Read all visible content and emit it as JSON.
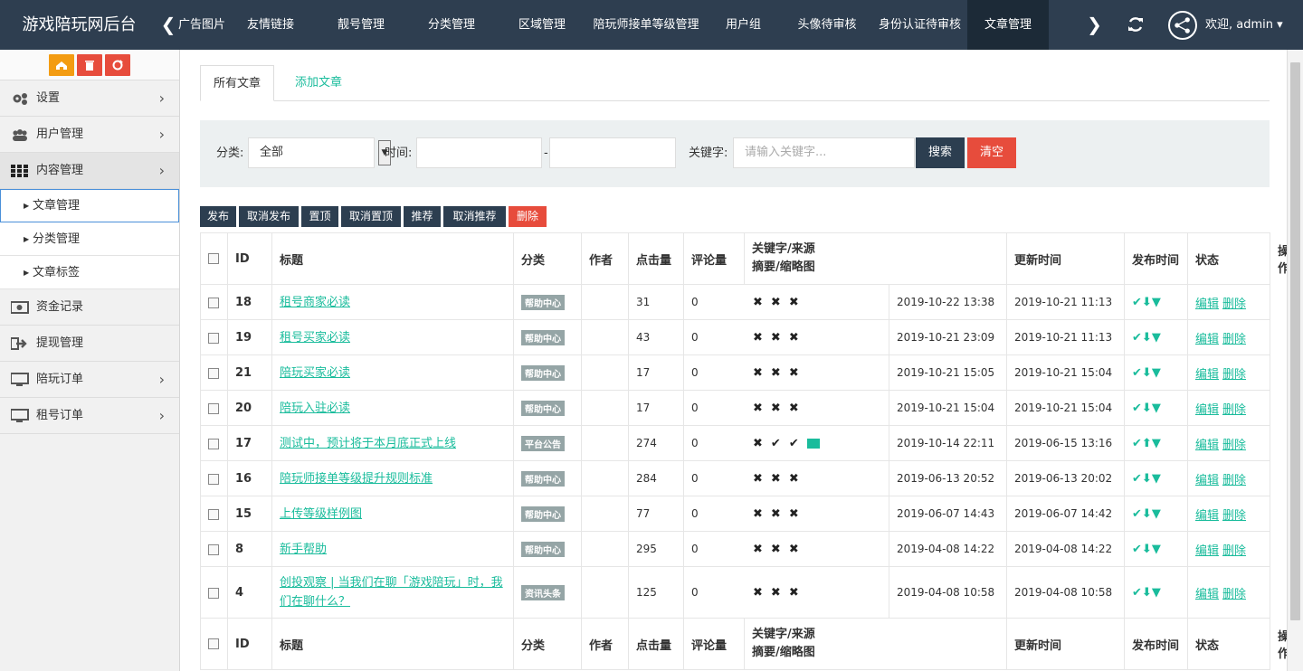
{
  "app": {
    "title": "游戏陪玩网后台"
  },
  "topnav": {
    "items": [
      "广告图片管理",
      "友情链接",
      "靓号管理",
      "分类管理",
      "区域管理",
      "陪玩师接单等级管理",
      "用户组",
      "头像待审核",
      "身份认证待审核",
      "文章管理"
    ],
    "active_index": 9,
    "user_label": "欢迎, admin"
  },
  "sidebar": {
    "items": [
      {
        "label": "设置",
        "icon": "cogs-icon",
        "has_arrow": true
      },
      {
        "label": "用户管理",
        "icon": "users-icon",
        "has_arrow": true
      },
      {
        "label": "内容管理",
        "icon": "grid-icon",
        "has_arrow": true,
        "open": true
      },
      {
        "label": "资金记录",
        "icon": "money-icon",
        "has_arrow": false
      },
      {
        "label": "提现管理",
        "icon": "sign-out-icon",
        "has_arrow": false
      },
      {
        "label": "陪玩订单",
        "icon": "monitor-icon",
        "has_arrow": true
      },
      {
        "label": "租号订单",
        "icon": "monitor-icon",
        "has_arrow": true
      }
    ],
    "subitems": [
      "文章管理",
      "分类管理",
      "文章标签"
    ],
    "current_sub": 0
  },
  "tabs": [
    {
      "label": "所有文章",
      "active": true
    },
    {
      "label": "添加文章",
      "active": false
    }
  ],
  "filter": {
    "category_label": "分类:",
    "category_value": "全部",
    "time_label": "时间:",
    "dash": "-",
    "keyword_label": "关键字:",
    "keyword_placeholder": "请输入关键字...",
    "search_label": "搜索",
    "clear_label": "清空"
  },
  "actions": [
    "发布",
    "取消发布",
    "置顶",
    "取消置顶",
    "推荐",
    "取消推荐",
    "删除"
  ],
  "table": {
    "headers": [
      "ID",
      "标题",
      "分类",
      "作者",
      "点击量",
      "评论量",
      "关键字/来源",
      "摘要/缩略图",
      "更新时间",
      "发布时间",
      "状态",
      "操作"
    ],
    "edit_label": "编辑",
    "delete_label": "删除",
    "rows": [
      {
        "id": "18",
        "title": "租号商家必读",
        "category": "帮助中心",
        "author": "",
        "hits": "31",
        "comments": "0",
        "flags": "xxx",
        "updated": "2019-10-22 13:38",
        "published": "2019-10-21 11:13",
        "status": [
          "check",
          "down",
          "thumb"
        ]
      },
      {
        "id": "19",
        "title": "租号买家必读",
        "category": "帮助中心",
        "author": "",
        "hits": "43",
        "comments": "0",
        "flags": "xxx",
        "updated": "2019-10-21 23:09",
        "published": "2019-10-21 11:13",
        "status": [
          "check",
          "down",
          "thumb"
        ]
      },
      {
        "id": "21",
        "title": "陪玩买家必读",
        "category": "帮助中心",
        "author": "",
        "hits": "17",
        "comments": "0",
        "flags": "xxx",
        "updated": "2019-10-21 15:05",
        "published": "2019-10-21 15:04",
        "status": [
          "check",
          "down",
          "thumb"
        ]
      },
      {
        "id": "20",
        "title": "陪玩入驻必读",
        "category": "帮助中心",
        "author": "",
        "hits": "17",
        "comments": "0",
        "flags": "xxx",
        "updated": "2019-10-21 15:04",
        "published": "2019-10-21 15:04",
        "status": [
          "check",
          "down",
          "thumb"
        ]
      },
      {
        "id": "17",
        "title": "测试中，预计将于本月底正式上线",
        "category": "平台公告",
        "author": "",
        "hits": "274",
        "comments": "0",
        "flags": "xvvp",
        "updated": "2019-10-14 22:11",
        "published": "2019-06-15 13:16",
        "status": [
          "check",
          "up",
          "thumb"
        ]
      },
      {
        "id": "16",
        "title": "陪玩师接单等级提升规则标准",
        "category": "帮助中心",
        "author": "",
        "hits": "284",
        "comments": "0",
        "flags": "xxx",
        "updated": "2019-06-13 20:52",
        "published": "2019-06-13 20:02",
        "status": [
          "check",
          "down",
          "thumb"
        ]
      },
      {
        "id": "15",
        "title": "上传等级样例图",
        "category": "帮助中心",
        "author": "",
        "hits": "77",
        "comments": "0",
        "flags": "xxx",
        "updated": "2019-06-07 14:43",
        "published": "2019-06-07 14:42",
        "status": [
          "check",
          "down",
          "thumb"
        ]
      },
      {
        "id": "8",
        "title": "新手帮助",
        "category": "帮助中心",
        "author": "",
        "hits": "295",
        "comments": "0",
        "flags": "xxx",
        "updated": "2019-04-08 14:22",
        "published": "2019-04-08 14:22",
        "status": [
          "check",
          "down",
          "thumb"
        ]
      },
      {
        "id": "4",
        "title": "创投观察 | 当我们在聊「游戏陪玩」时，我们在聊什么？",
        "category": "资讯头条",
        "author": "",
        "hits": "125",
        "comments": "0",
        "flags": "xxx",
        "updated": "2019-04-08 10:58",
        "published": "2019-04-08 10:58",
        "status": [
          "check",
          "down",
          "thumb"
        ]
      }
    ]
  },
  "colors": {
    "topbar": "#2e3e50",
    "accent": "#1abc9c",
    "danger": "#e74c3c",
    "dark_btn": "#2c3e50",
    "orange": "#f39c12"
  }
}
